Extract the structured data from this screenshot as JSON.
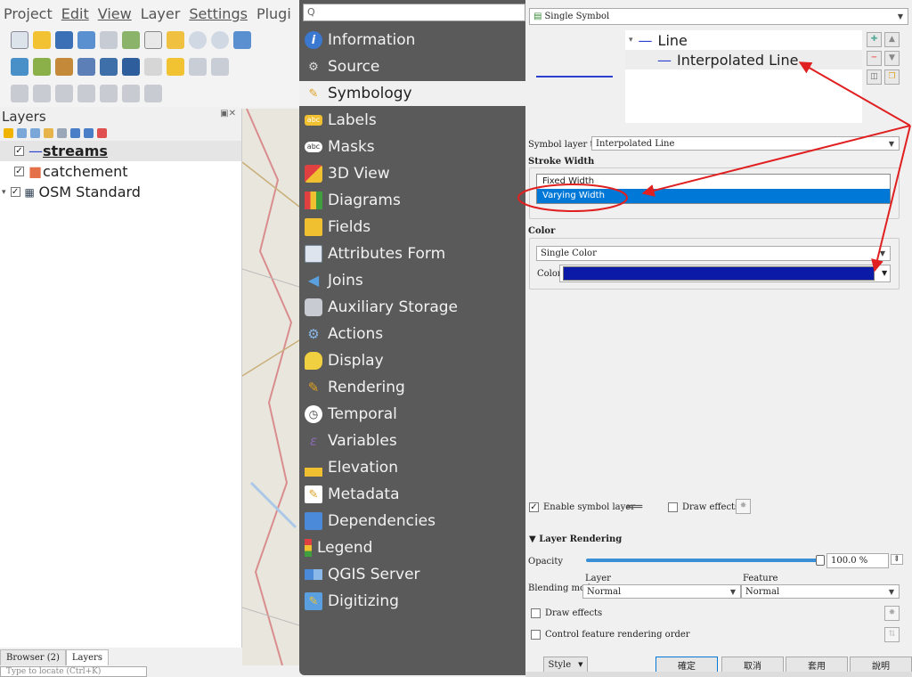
{
  "menu": [
    "Project",
    "Edit",
    "View",
    "Layer",
    "Settings",
    "Plugi"
  ],
  "layers_panel": {
    "title": "Layers",
    "layers": [
      {
        "name": "streams",
        "checked": "✓",
        "symbol": "—"
      },
      {
        "name": "catchement",
        "checked": "✓",
        "symbol": "■"
      },
      {
        "name": "OSM Standard",
        "checked": "✓",
        "symbol": "▦"
      }
    ],
    "tabs": [
      "Browser (2)",
      "Layers"
    ],
    "locator_placeholder": "Type to locate (Ctrl+K)"
  },
  "dialog_nav": {
    "search_placeholder": "Q",
    "items": [
      {
        "label": "Information",
        "icon": "information-icon"
      },
      {
        "label": "Source",
        "icon": "source-icon"
      },
      {
        "label": "Symbology",
        "icon": "symbology-icon"
      },
      {
        "label": "Labels",
        "icon": "labels-icon"
      },
      {
        "label": "Masks",
        "icon": "masks-icon"
      },
      {
        "label": "3D View",
        "icon": "3d-view-icon"
      },
      {
        "label": "Diagrams",
        "icon": "diagrams-icon"
      },
      {
        "label": "Fields",
        "icon": "fields-icon"
      },
      {
        "label": "Attributes Form",
        "icon": "attributes-form-icon"
      },
      {
        "label": "Joins",
        "icon": "joins-icon"
      },
      {
        "label": "Auxiliary Storage",
        "icon": "auxiliary-storage-icon"
      },
      {
        "label": "Actions",
        "icon": "actions-icon"
      },
      {
        "label": "Display",
        "icon": "display-icon"
      },
      {
        "label": "Rendering",
        "icon": "rendering-icon"
      },
      {
        "label": "Temporal",
        "icon": "temporal-icon"
      },
      {
        "label": "Variables",
        "icon": "variables-icon"
      },
      {
        "label": "Elevation",
        "icon": "elevation-icon"
      },
      {
        "label": "Metadata",
        "icon": "metadata-icon"
      },
      {
        "label": "Dependencies",
        "icon": "dependencies-icon"
      },
      {
        "label": "Legend",
        "icon": "legend-icon"
      },
      {
        "label": "QGIS Server",
        "icon": "qgis-server-icon"
      },
      {
        "label": "Digitizing",
        "icon": "digitizing-icon"
      }
    ],
    "active": "Symbology"
  },
  "symbology": {
    "renderer": "Single Symbol",
    "tree": {
      "root": "Line",
      "child": "Interpolated Line"
    },
    "symbol_layer_type_label": "Symbol layer type",
    "symbol_layer_type": "Interpolated Line",
    "stroke_width_title": "Stroke Width",
    "width_options": [
      "Fixed Width",
      "Varying Width"
    ],
    "selected_width_option": "Varying Width",
    "color_title": "Color",
    "color_mode": "Single Color",
    "color_label": "Color",
    "color_value": "#0c1aa8",
    "enable_symbol_layer": "Enable symbol layer",
    "draw_effects_label": "Draw effects",
    "layer_rendering_title": "Layer Rendering",
    "opacity_label": "Opacity",
    "opacity_value": "100.0 %",
    "opacity_fraction": 1.0,
    "blending_label": "Blending mode",
    "layer_col": "Layer",
    "feature_col": "Feature",
    "layer_blend": "Normal",
    "feature_blend": "Normal",
    "draw_effects_2": "Draw effects",
    "control_order": "Control feature rendering order"
  },
  "buttons": {
    "style": "Style",
    "ok": "確定",
    "cancel": "取消",
    "apply": "套用",
    "help": "說明"
  },
  "colors": {
    "annotation": "#e02020",
    "selection": "#0078d7",
    "accent": "#0c1aa8"
  }
}
